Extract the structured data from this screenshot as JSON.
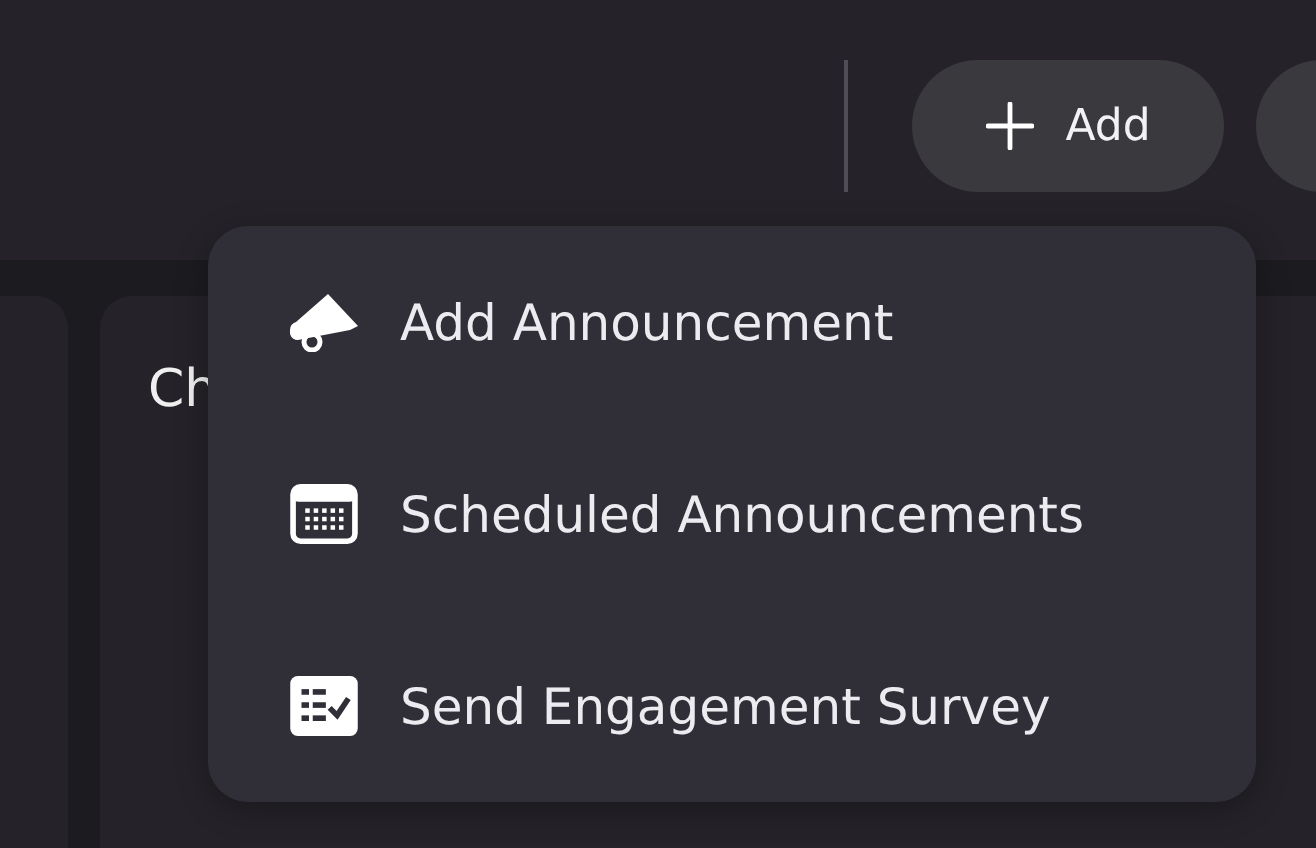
{
  "toolbar": {
    "add_button": {
      "label": "Add"
    }
  },
  "cards": [
    {
      "kind": "blank"
    },
    {
      "kind": "titled",
      "title": "Ch"
    }
  ],
  "add_menu": {
    "items": [
      {
        "kind": "megaphone",
        "label": "Add Announcement"
      },
      {
        "kind": "calendar",
        "label": "Scheduled Announcements"
      },
      {
        "kind": "checklist",
        "label": "Send Engagement Survey"
      }
    ]
  }
}
